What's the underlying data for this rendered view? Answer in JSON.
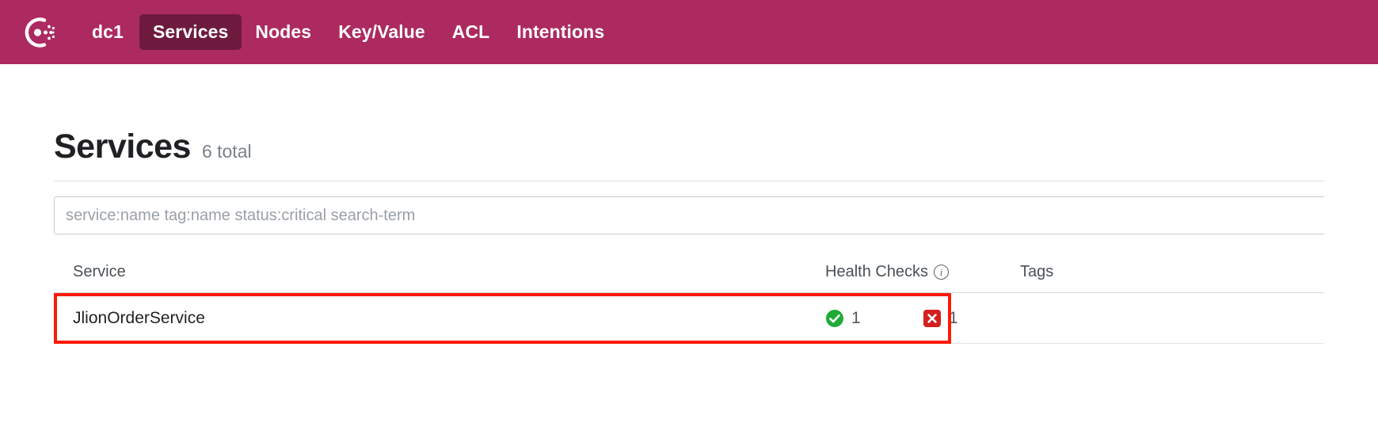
{
  "brand": {
    "logo_icon": "consul-logo-icon",
    "nav_bg": "#ac2a60",
    "nav_active_bg": "#6e1a3e"
  },
  "nav": {
    "datacenter": "dc1",
    "items": [
      {
        "label": "Services",
        "active": true
      },
      {
        "label": "Nodes",
        "active": false
      },
      {
        "label": "Key/Value",
        "active": false
      },
      {
        "label": "ACL",
        "active": false
      },
      {
        "label": "Intentions",
        "active": false
      }
    ]
  },
  "page": {
    "title": "Services",
    "total": "6 total"
  },
  "search": {
    "placeholder": "service:name tag:name status:critical search-term",
    "value": ""
  },
  "table": {
    "columns": {
      "service": "Service",
      "health": "Health Checks",
      "health_info_icon": "info-icon",
      "tags": "Tags"
    },
    "rows": [
      {
        "service": "JlionOrderService",
        "highlighted": true,
        "highlight_color": "#fa1a07",
        "health": [
          {
            "status": "passing",
            "icon": "check-circle-icon",
            "count": "1",
            "color": "#20ab38"
          },
          {
            "status": "critical",
            "icon": "x-square-icon",
            "count": "1",
            "color": "#d42020"
          }
        ],
        "tags": ""
      }
    ]
  }
}
